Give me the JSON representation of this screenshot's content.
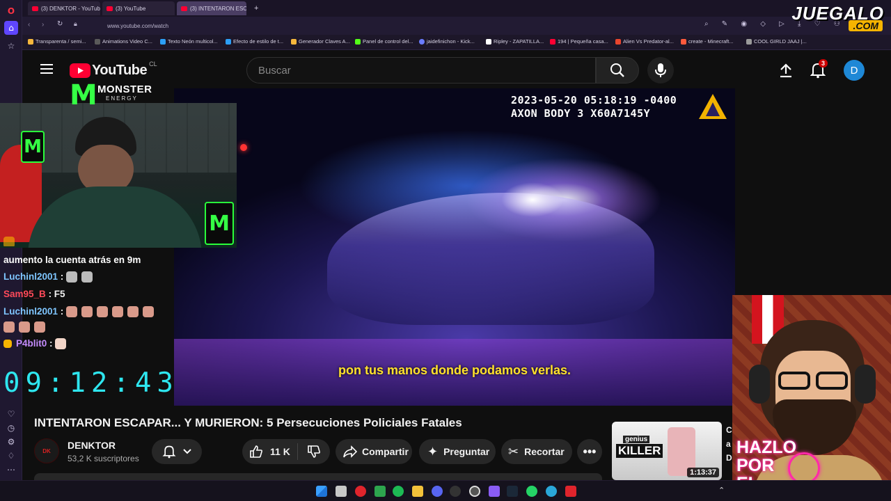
{
  "browser": {
    "tabs": [
      {
        "label": "(3) DENKTOR - YouTube",
        "active": false
      },
      {
        "label": "(3) YouTube",
        "active": false
      },
      {
        "label": "(3) INTENTARON ESCA",
        "active": true
      }
    ],
    "url": "www.youtube.com/watch",
    "bookmarks": [
      "Transparenta / semi...",
      "Animations Video C...",
      "Texto Neón multicol...",
      "Efecto de estilo de t...",
      "Generador Claves A...",
      "Panel de control del...",
      "jaidefinichon - Kick...",
      "Ripley - ZAPATILLA...",
      "194 | Pequeña casa...",
      "Alien Vs Predator-al...",
      "create - Minecraft...",
      "COOL GIRLD JAAJ |..."
    ]
  },
  "youtube": {
    "logo_text": "YouTube",
    "country": "CL",
    "search_placeholder": "Buscar",
    "notifications_count": "3",
    "avatar_letter": "D"
  },
  "video": {
    "bodycam_line1": "2023-05-20 05:18:19 -0400",
    "bodycam_line2": "AXON BODY 3 X60A7145Y",
    "subtitle": "pon tus manos donde podamos verlas.",
    "title": "INTENTARON ESCAPAR... Y MURIERON: 5 Persecuciones Policiales Fatales"
  },
  "channel": {
    "name": "DENKTOR",
    "subscribers": "53,2 K suscriptores"
  },
  "actions": {
    "likes": "11 K",
    "share": "Compartir",
    "ask": "Preguntar",
    "clip": "Recortar"
  },
  "overlay": {
    "brand_line1": "MONSTER",
    "brand_line2": "ENERGY",
    "chat": [
      {
        "user": "",
        "text": "aumento la cuenta atrás en 9m",
        "user_color": "#ffffff"
      },
      {
        "user": "Luchinl2001",
        "text": ":",
        "user_color": "#7fc6ff"
      },
      {
        "user": "Sam95_B",
        "text": ": F5",
        "user_color": "#ff4a5a"
      },
      {
        "user": "Luchinl2001",
        "text": ":",
        "user_color": "#7fc6ff"
      },
      {
        "user": "P4blit0",
        "text": ":",
        "user_color": "#c58cff"
      }
    ],
    "countdown": "09:12:43",
    "banner": [
      "HAZLO",
      "POR",
      "EL"
    ],
    "watermark_line1": "JUEGALO",
    "watermark_line2": ".COM"
  },
  "recommendation": {
    "thumb_text_top": "genius",
    "thumb_text_main": "KILLER",
    "duration": "1:13:37"
  },
  "colors": {
    "youtube_red": "#ff0033",
    "subtitle_yellow": "#ffe12b",
    "countdown_cyan": "#2ee6ef",
    "monster_green": "#35ff45"
  }
}
